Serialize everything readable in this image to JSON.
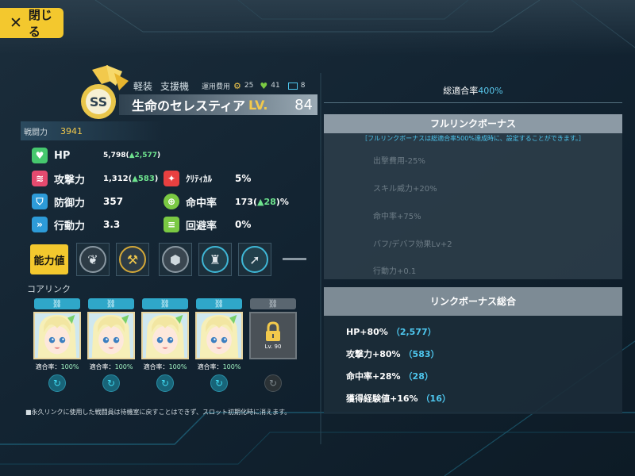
{
  "close_button": {
    "label": "閉じる",
    "icon": "close-icon"
  },
  "unit": {
    "category": "軽装",
    "role": "支援機",
    "cost_label": "運用費用",
    "cost_parts": "25",
    "cost_energy": "41",
    "cost_other": "8",
    "name": "生命のセレスティア",
    "lv_label": "LV.",
    "level": "84",
    "power_label": "戦闘力",
    "power": "3941"
  },
  "stats": {
    "hp": {
      "label": "HP",
      "value": "5,798",
      "bonus_open": "(",
      "bonus": "▲2,577",
      "bonus_close": ")"
    },
    "atk": {
      "label": "攻撃力",
      "value": "1,312",
      "bonus_open": "(",
      "bonus": "▲583",
      "bonus_close": ")"
    },
    "def": {
      "label": "防御力",
      "value": "357"
    },
    "spd": {
      "label": "行動力",
      "value": "3.3"
    },
    "crit": {
      "label": "ｸﾘﾃｨｶﾙ",
      "value": "5%"
    },
    "acc": {
      "label": "命中率",
      "value": "173",
      "bonus_open": "(",
      "bonus": "▲28",
      "bonus_close": ")",
      "suffix": "%"
    },
    "eva": {
      "label": "回避率",
      "value": "0%"
    }
  },
  "ability_button": "能力値",
  "skill_icons": [
    "wing-skill-icon",
    "mech-skill-icon",
    "hex-shield-skill-icon",
    "trophy-skill-icon",
    "arrow-skill-icon"
  ],
  "core_link": {
    "title": "コアリンク",
    "rate_label": "適合率：",
    "slots": [
      {
        "rate": "100%",
        "locked": false
      },
      {
        "rate": "100%",
        "locked": false
      },
      {
        "rate": "100%",
        "locked": false
      },
      {
        "rate": "100%",
        "locked": false
      },
      {
        "rate": "",
        "locked": true,
        "lock_level": "Lv. 90"
      }
    ],
    "footnote": "■永久リンクに使用した戦闘員は待機室に戻すことはできず、スロット初期化時に消えます。"
  },
  "compat": {
    "label": "総適合率",
    "value": "400%"
  },
  "full_link": {
    "title": "フルリンクボーナス",
    "note": "［フルリンクボーナスは総適合率500%達成時に、設定することができます。］",
    "items": [
      "出撃費用-25%",
      "スキル威力+20%",
      "命中率+75%",
      "バフ/デバフ効果Lv+2",
      "行動力+0.1"
    ]
  },
  "link_total": {
    "title": "リンクボーナス総合",
    "items": [
      {
        "label": "HP+80%",
        "value": "（2,577）"
      },
      {
        "label": "攻撃力+80%",
        "value": "（583）"
      },
      {
        "label": "命中率+28%",
        "value": "（28）"
      },
      {
        "label": "獲得経験値+16%",
        "value": "（16）"
      }
    ]
  },
  "colors": {
    "accent_yellow": "#f3c82e",
    "accent_cyan": "#4ec7ef",
    "bonus_green": "#6ee38e"
  }
}
